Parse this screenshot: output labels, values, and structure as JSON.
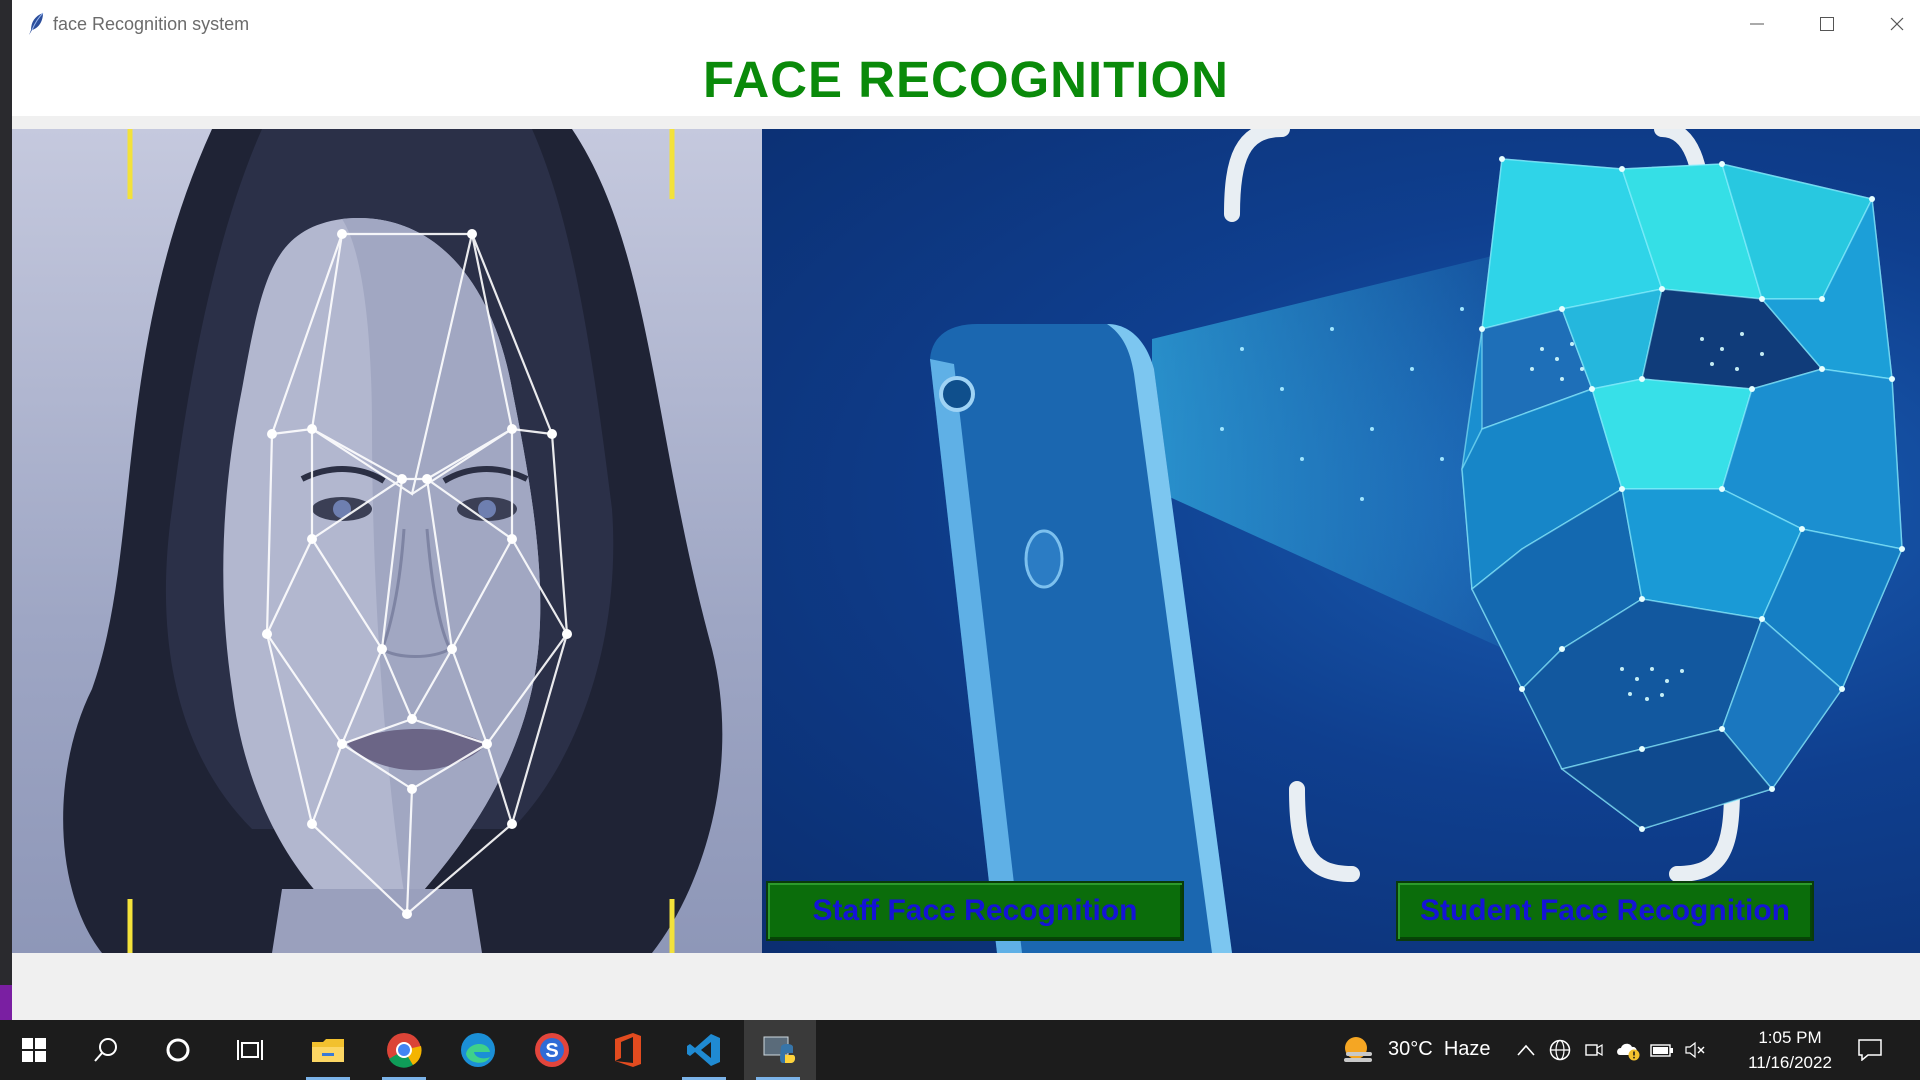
{
  "window": {
    "title": "face Recognition system",
    "heading": "FACE RECOGNITION"
  },
  "buttons": {
    "staff_label": "Staff Face Recognition",
    "student_label": "Student Face Recognition"
  },
  "taskbar": {
    "pinned": [
      "start-icon",
      "search-icon",
      "cortana-icon",
      "task-view-icon",
      "file-explorer-icon",
      "chrome-icon",
      "edge-icon",
      "s-app-icon",
      "office-icon",
      "vscode-icon",
      "python-app-icon"
    ],
    "active_app": "python-app-icon",
    "weather": {
      "temp": "30°C",
      "condition": "Haze"
    },
    "clock": {
      "time": "1:05 PM",
      "date": "11/16/2022"
    }
  },
  "colors": {
    "heading": "#0a8a0a",
    "button_bg": "#0b6d0b",
    "button_text": "#1414d6",
    "taskbar_bg": "#1c1c1c"
  }
}
